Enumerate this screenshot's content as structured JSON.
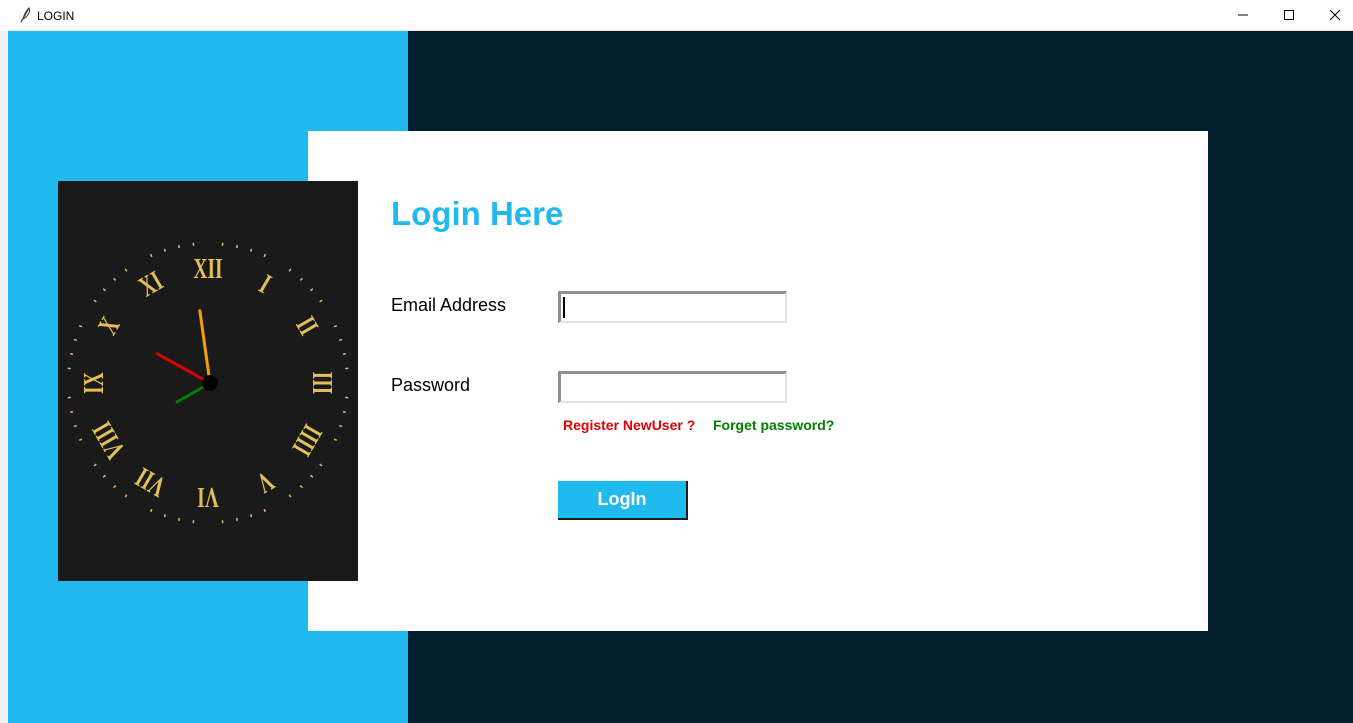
{
  "window": {
    "title": "LOGIN",
    "app_icon": "feather-icon",
    "controls": {
      "minimize": "minimize-icon",
      "maximize": "maximize-icon",
      "close": "close-icon"
    }
  },
  "clock": {
    "style": "roman-numeral analog clock",
    "numerals": [
      "XII",
      "I",
      "II",
      "III",
      "IIII",
      "V",
      "VI",
      "VII",
      "VIII",
      "IX",
      "X",
      "XI"
    ],
    "time": {
      "hours": 9,
      "minutes": 58,
      "seconds": 40
    }
  },
  "form": {
    "heading": "Login Here",
    "email_label": "Email Address",
    "email_value": "",
    "password_label": "Password",
    "password_value": "",
    "register_link": "Register NewUser ?",
    "forget_link": "Forget password?",
    "login_button": "LogIn"
  },
  "colors": {
    "accent_blue": "#21baef",
    "dark_navy": "#021e2f",
    "clock_bg": "#1a1a1a",
    "numeral_gold": "#e3bf57",
    "register_red": "#e00000",
    "forget_green": "#008000",
    "hour_hand": "#e00000",
    "minute_hand": "#f5a000",
    "second_hand": "#008000"
  }
}
